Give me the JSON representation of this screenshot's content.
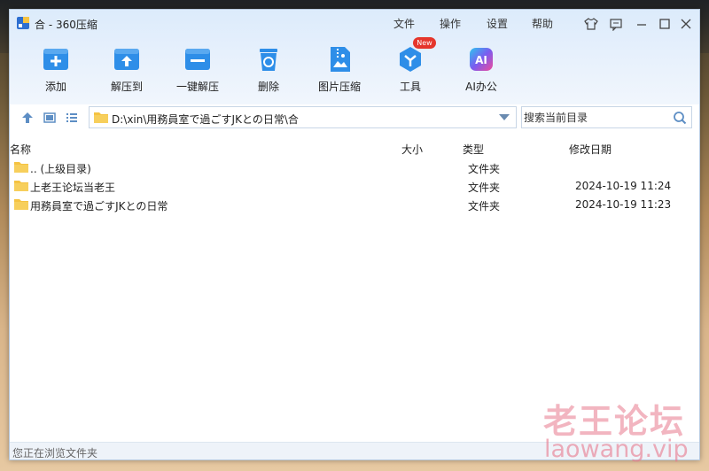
{
  "window": {
    "title": "合 - 360压缩",
    "menu": [
      "文件",
      "操作",
      "设置",
      "帮助"
    ]
  },
  "toolbar": {
    "items": [
      {
        "label": "添加",
        "icon": "add-icon"
      },
      {
        "label": "解压到",
        "icon": "extract-to-icon"
      },
      {
        "label": "一键解压",
        "icon": "one-click-extract-icon"
      },
      {
        "label": "删除",
        "icon": "delete-icon"
      },
      {
        "label": "图片压缩",
        "icon": "image-compress-icon"
      },
      {
        "label": "工具",
        "icon": "tools-icon",
        "badge": "New"
      },
      {
        "label": "AI办公",
        "icon": "ai-office-icon",
        "icon_text": "AI"
      }
    ]
  },
  "address": {
    "path": "D:\\xin\\用務員室で過ごすJKとの日常\\合"
  },
  "search": {
    "placeholder": "搜索当前目录"
  },
  "columns": {
    "name": "名称",
    "size": "大小",
    "type": "类型",
    "modified": "修改日期"
  },
  "files": [
    {
      "name": ".. (上级目录)",
      "size": "",
      "type": "文件夹",
      "modified": ""
    },
    {
      "name": "上老王论坛当老王",
      "size": "",
      "type": "文件夹",
      "modified": "2024-10-19 11:24"
    },
    {
      "name": "用務員室で過ごすJKとの日常",
      "size": "",
      "type": "文件夹",
      "modified": "2024-10-19 11:23"
    }
  ],
  "status": {
    "text": "您正在浏览文件夹"
  },
  "watermark": {
    "cn": "老王论坛",
    "url": "laowang.vip"
  },
  "colors": {
    "accent_blue": "#2e8ee8",
    "badge_red": "#e5362c",
    "folder_yellow": "#f5c342",
    "title_band": "#dcebfb"
  }
}
